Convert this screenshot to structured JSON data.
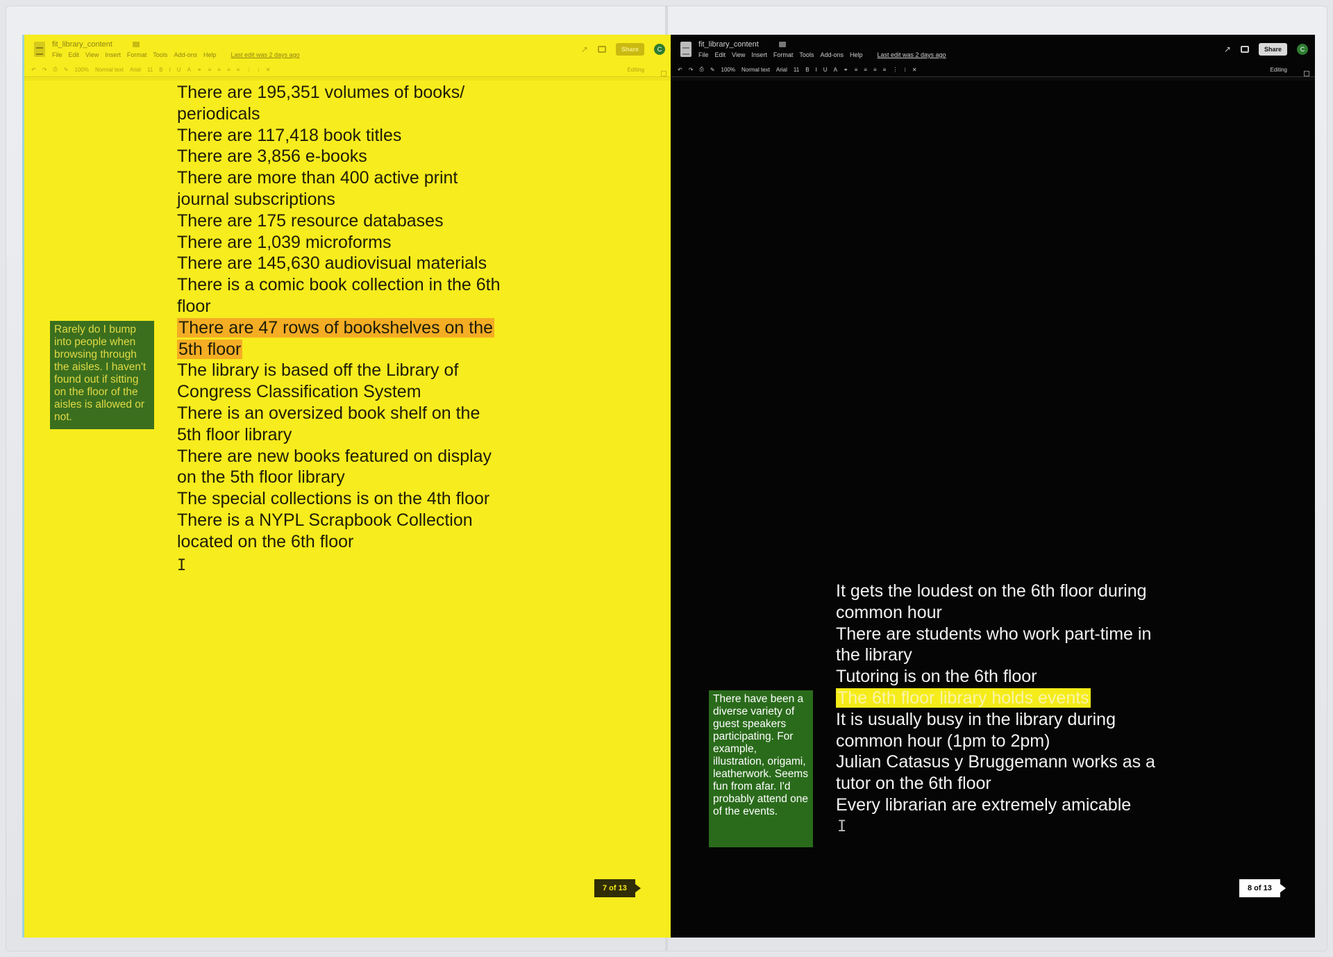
{
  "left_page": {
    "doc_title": "fit_library_content",
    "menu": [
      "File",
      "Edit",
      "View",
      "Insert",
      "Format",
      "Tools",
      "Add-ons",
      "Help"
    ],
    "last_edit": "Last edit was 2 days ago",
    "toolbar": {
      "zoom": "100%",
      "style": "Normal text",
      "font": "Arial",
      "size": "11",
      "mode": "Editing"
    },
    "share_label": "Share",
    "avatar_initial": "C",
    "lines": [
      "There are 195,351 volumes of books/",
      "periodicals",
      "There are 117,418 book titles",
      "There are 3,856 e-books",
      "There are more than 400 active print",
      "journal subscriptions",
      "There are 175 resource databases",
      "There are 1,039 microforms",
      "There are 145,630 audiovisual materials",
      "There is a comic book collection in the 6th",
      "floor"
    ],
    "highlight": [
      "There are 47 rows of bookshelves on the",
      "5th floor"
    ],
    "lines_after": [
      "The library is based off the Library of",
      "Congress Classification System",
      "There is an oversized book shelf on the",
      "5th floor library",
      "There are new books featured on display",
      "on the 5th floor library",
      "The special collections is on the 4th floor",
      "There is a NYPL Scrapbook Collection",
      "located on the 6th floor"
    ],
    "comment": "Rarely do I bump into people when browsing through the aisles. I haven't found out if sitting on the floor of the aisles is allowed or not.",
    "page_label": "7 of 13"
  },
  "right_page": {
    "doc_title": "fit_library_content",
    "menu": [
      "File",
      "Edit",
      "View",
      "Insert",
      "Format",
      "Tools",
      "Add-ons",
      "Help"
    ],
    "last_edit": "Last edit was 2 days ago",
    "toolbar": {
      "zoom": "100%",
      "style": "Normal text",
      "font": "Arial",
      "size": "11",
      "mode": "Editing"
    },
    "share_label": "Share",
    "avatar_initial": "C",
    "lines": [
      "It gets the loudest on the 6th floor during",
      "common hour",
      "There are students who work part-time in",
      "the library",
      "Tutoring is on the 6th floor"
    ],
    "highlight": "The 6th floor library holds events",
    "lines_after": [
      "It is usually busy in the library during",
      "common hour (1pm to 2pm)",
      "Julian Catasus y Bruggemann works as a",
      "tutor on the 6th floor",
      "Every librarian are extremely amicable"
    ],
    "comment": "There have been a diverse variety of guest speakers participating. For example, illustration, origami, leatherwork. Seems fun from afar. I'd probably attend one of the events.",
    "page_label": "8 of 13"
  },
  "colors": {
    "left_bg": "#f7ec1d",
    "left_highlight": "#f5ad24",
    "right_bg": "#050505",
    "right_highlight": "#f5ec1a",
    "comment_green": "#2a6b1b"
  },
  "icons": [
    "doc-icon",
    "folder-icon",
    "trend-icon",
    "comment-icon",
    "share-icon",
    "avatar",
    "undo-icon",
    "redo-icon",
    "print-icon",
    "paint-format-icon",
    "bold-icon",
    "italic-icon",
    "underline-icon",
    "text-cursor-icon"
  ]
}
